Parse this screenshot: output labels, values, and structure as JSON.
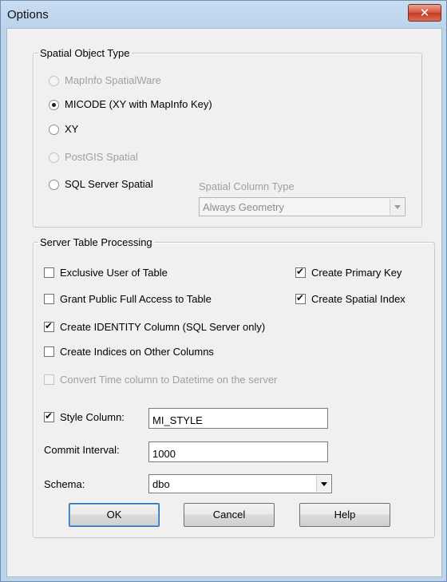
{
  "window": {
    "title": "Options",
    "close_glyph": "✕"
  },
  "spatial_group": {
    "legend": "Spatial Object Type",
    "options": [
      {
        "label": "MapInfo SpatialWare",
        "checked": false,
        "disabled": true
      },
      {
        "label": "MICODE (XY with MapInfo Key)",
        "checked": true,
        "disabled": false
      },
      {
        "label": "XY",
        "checked": false,
        "disabled": false
      },
      {
        "label": "PostGIS Spatial",
        "checked": false,
        "disabled": true
      },
      {
        "label": "SQL Server Spatial",
        "checked": false,
        "disabled": false
      }
    ],
    "column_type_label": "Spatial Column Type",
    "column_type_value": "Always Geometry"
  },
  "server_group": {
    "legend": "Server Table Processing",
    "exclusive_user": {
      "label": "Exclusive User of Table",
      "checked": false
    },
    "create_primary_key": {
      "label": "Create Primary Key",
      "checked": true
    },
    "grant_public": {
      "label": "Grant Public Full Access to Table",
      "checked": false
    },
    "create_spatial_index": {
      "label": "Create Spatial Index",
      "checked": true
    },
    "create_identity": {
      "label": "Create IDENTITY Column (SQL Server only)",
      "checked": true
    },
    "create_indices": {
      "label": "Create Indices on Other Columns",
      "checked": false
    },
    "convert_time": {
      "label": "Convert Time column to Datetime on the server",
      "checked": false,
      "disabled": true
    },
    "style_column": {
      "label": "Style Column:",
      "checked": true,
      "value": "MI_STYLE"
    },
    "commit_interval": {
      "label": "Commit Interval:",
      "value": "1000"
    },
    "schema": {
      "label": "Schema:",
      "value": "dbo"
    }
  },
  "buttons": {
    "ok": "OK",
    "cancel": "Cancel",
    "help": "Help"
  }
}
